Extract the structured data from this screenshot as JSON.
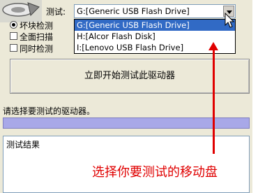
{
  "test_label": "测试:",
  "combo": {
    "selected": "G:[Generic USB Flash Drive]"
  },
  "dropdown_items": [
    "G:[Generic USB Flash Drive]",
    "H:[Alcor Flash Disk]",
    "I:[Lenovo USB Flash Drive]"
  ],
  "options": {
    "bad_block": "坏块检测",
    "full_scan": "全面扫描",
    "simultaneous": "同时检测"
  },
  "start_button": "立即开始测试此驱动器",
  "prompt": "请选择要测试的驱动器。",
  "results_label": "测试结果",
  "annotation": "选择你要测试的移动盘",
  "colors": {
    "selection": "#316ac5",
    "progress": "#a8a8e8",
    "annotation": "#e00000"
  }
}
